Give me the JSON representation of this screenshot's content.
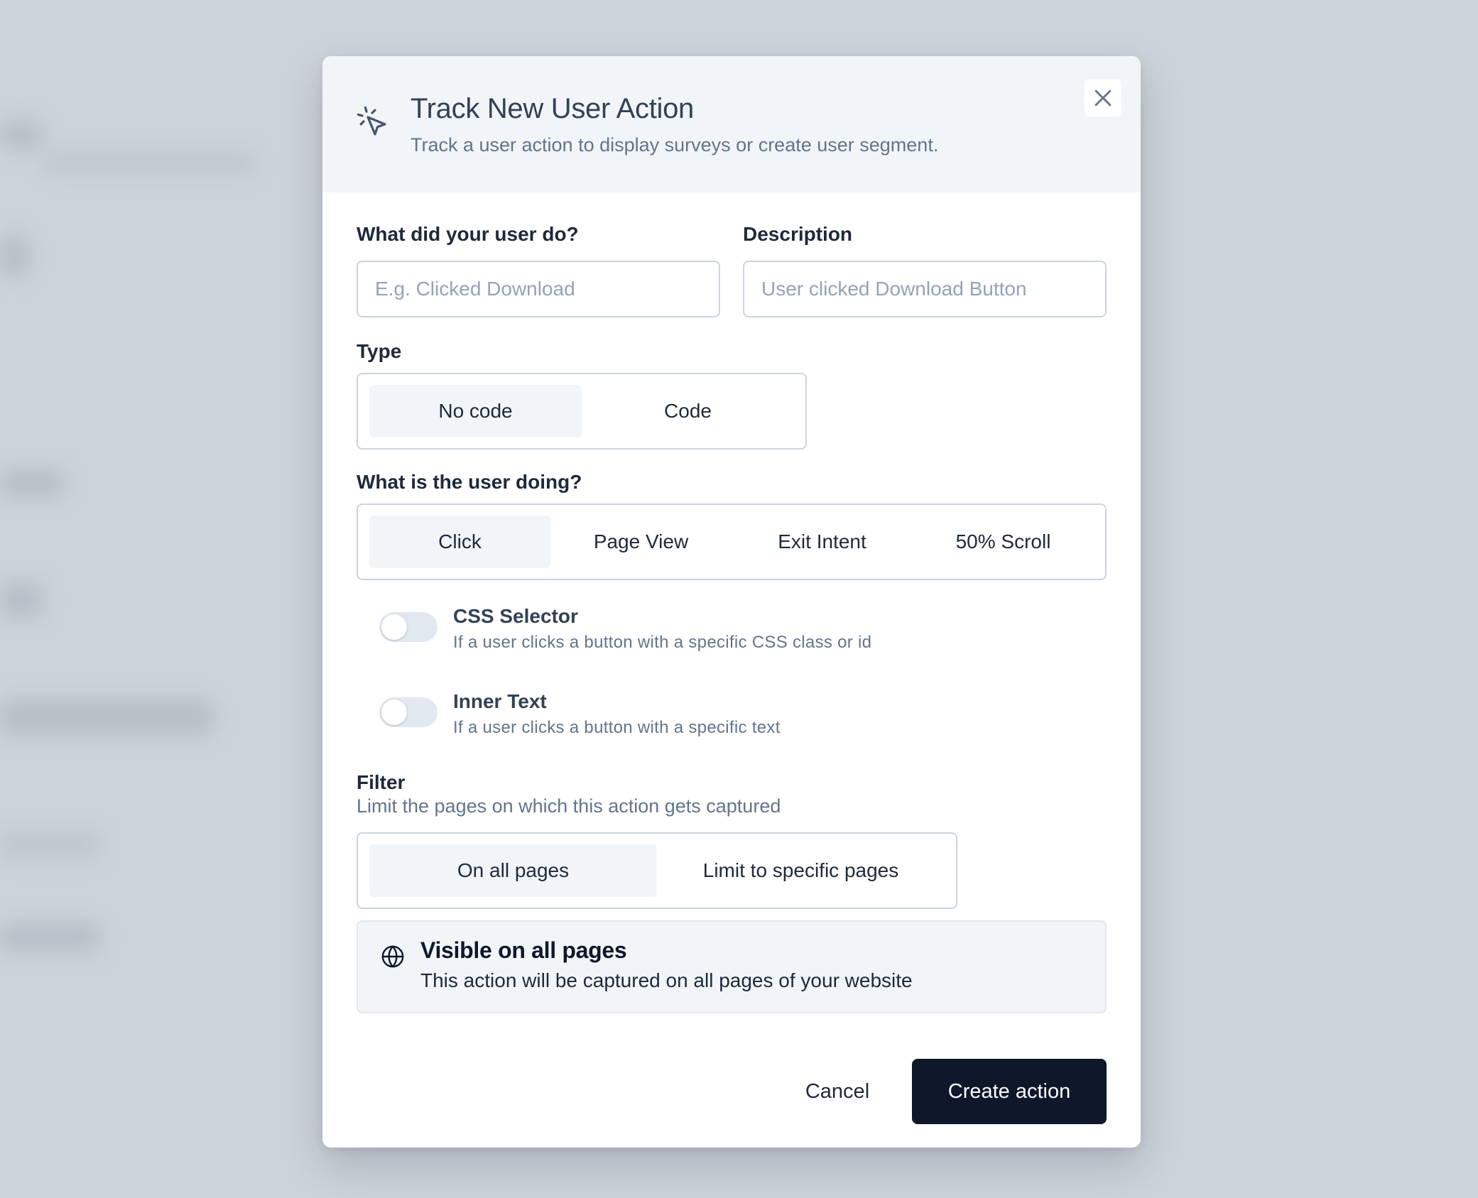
{
  "modal": {
    "icon": "cursor-click-icon",
    "title": "Track New User Action",
    "subtitle": "Track a user action to display surveys or create user segment.",
    "close_icon": "close-icon"
  },
  "form": {
    "name": {
      "label": "What did your user do?",
      "placeholder": "E.g. Clicked Download",
      "value": ""
    },
    "description": {
      "label": "Description",
      "placeholder": "User clicked Download Button",
      "value": ""
    },
    "type": {
      "label": "Type",
      "options": [
        "No code",
        "Code"
      ],
      "selected": "No code"
    },
    "event": {
      "label": "What is the user doing?",
      "options": [
        "Click",
        "Page View",
        "Exit Intent",
        "50% Scroll"
      ],
      "selected": "Click"
    },
    "css_selector": {
      "title": "CSS Selector",
      "description": "If a user clicks a button with a specific CSS class or id",
      "enabled": false
    },
    "inner_text": {
      "title": "Inner Text",
      "description": "If a user clicks a button with a specific text",
      "enabled": false
    },
    "filter": {
      "label": "Filter",
      "subtitle": "Limit the pages on which this action gets captured",
      "options": [
        "On all pages",
        "Limit to specific pages"
      ],
      "selected": "On all pages"
    },
    "info": {
      "icon": "globe-icon",
      "title": "Visible on all pages",
      "description": "This action will be captured on all pages of your website"
    }
  },
  "footer": {
    "cancel_label": "Cancel",
    "create_label": "Create action"
  },
  "colors": {
    "primary": "#0f172a",
    "header_bg": "#f1f5f8",
    "border": "#cbd5e1"
  }
}
